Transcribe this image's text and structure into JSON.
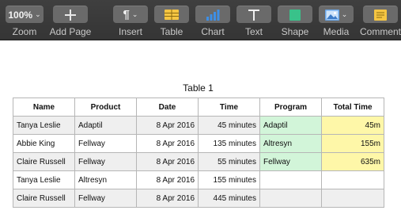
{
  "toolbar": {
    "zoom": {
      "value": "100%",
      "label": "Zoom"
    },
    "add_page": {
      "label": "Add Page"
    },
    "insert": {
      "label": "Insert"
    },
    "table": {
      "label": "Table",
      "icon": "table-icon",
      "color": "#f5c542"
    },
    "chart": {
      "label": "Chart",
      "icon": "bar-chart-icon",
      "color": "#3d8fe6"
    },
    "text": {
      "label": "Text",
      "icon": "text-box-icon"
    },
    "shape": {
      "label": "Shape",
      "icon": "square-shape-icon",
      "color": "#39c28a"
    },
    "media": {
      "label": "Media",
      "icon": "image-icon",
      "color": "#6aa6e8"
    },
    "comment": {
      "label": "Comment",
      "icon": "comment-icon",
      "color": "#f5c542"
    }
  },
  "document": {
    "table_title": "Table 1",
    "headers": [
      "Name",
      "Product",
      "Date",
      "Time",
      "Program",
      "Total Time"
    ],
    "rows": [
      {
        "name": "Tanya Leslie",
        "product": "Adaptil",
        "date": "8 Apr 2016",
        "time": "45 minutes",
        "program": "Adaptil",
        "total": "45m"
      },
      {
        "name": "Abbie King",
        "product": "Fellway",
        "date": "8 Apr 2016",
        "time": "135 minutes",
        "program": "Altresyn",
        "total": "155m"
      },
      {
        "name": "Claire Russell",
        "product": "Fellway",
        "date": "8 Apr 2016",
        "time": "55 minutes",
        "program": "Fellway",
        "total": "635m"
      },
      {
        "name": "Tanya Leslie",
        "product": "Altresyn",
        "date": "8 Apr 2016",
        "time": "155 minutes",
        "program": "",
        "total": ""
      },
      {
        "name": "Claire Russell",
        "product": "Fellway",
        "date": "8 Apr 2016",
        "time": "445 minutes",
        "program": "",
        "total": ""
      }
    ]
  }
}
